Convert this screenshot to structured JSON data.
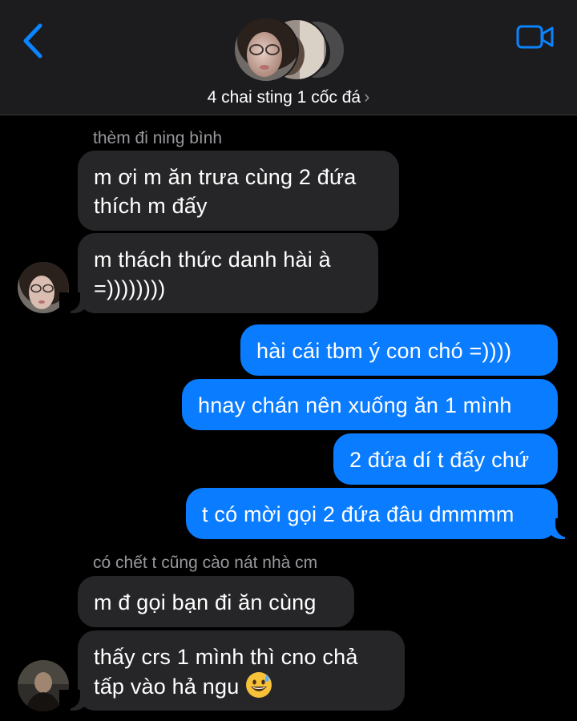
{
  "header": {
    "title": "4 chai sting 1 cốc đá",
    "chevron": "›",
    "back_icon": "chevron-left-icon",
    "video_icon": "video-camera-icon",
    "accent": "#0a84ff"
  },
  "messages": [
    {
      "type": "sender",
      "text": "thèm đi ning bình"
    },
    {
      "type": "incoming",
      "lines": [
        "m ơi m ăn trưa cùng 2 đứa",
        "thích m đấy"
      ]
    },
    {
      "type": "incoming",
      "lines": [
        "m thách thức danh hài à",
        "=))))))))"
      ]
    },
    {
      "type": "outgoing",
      "text": "hài cái tbm ý con chó =))))"
    },
    {
      "type": "outgoing",
      "text": "hnay chán nên xuống ăn 1 mình"
    },
    {
      "type": "outgoing",
      "text": "2 đứa dí t đấy chứ"
    },
    {
      "type": "outgoing",
      "text": "t có mời gọi 2 đứa đâu dmmmm"
    },
    {
      "type": "sender",
      "text": "có chết t cũng cào nát nhà cm"
    },
    {
      "type": "incoming",
      "text": "m đ gọi bạn đi ăn cùng"
    },
    {
      "type": "incoming",
      "lines": [
        "thấy crs 1 mình thì cno chả",
        "tấp vào hả ngu"
      ],
      "emoji": "grinning-sweat-emoji"
    }
  ],
  "colors": {
    "incoming_bubble": "#262628",
    "outgoing_bubble": "#0a7cff",
    "sender_text": "#98989d",
    "header_bg": "#1c1c1e"
  }
}
